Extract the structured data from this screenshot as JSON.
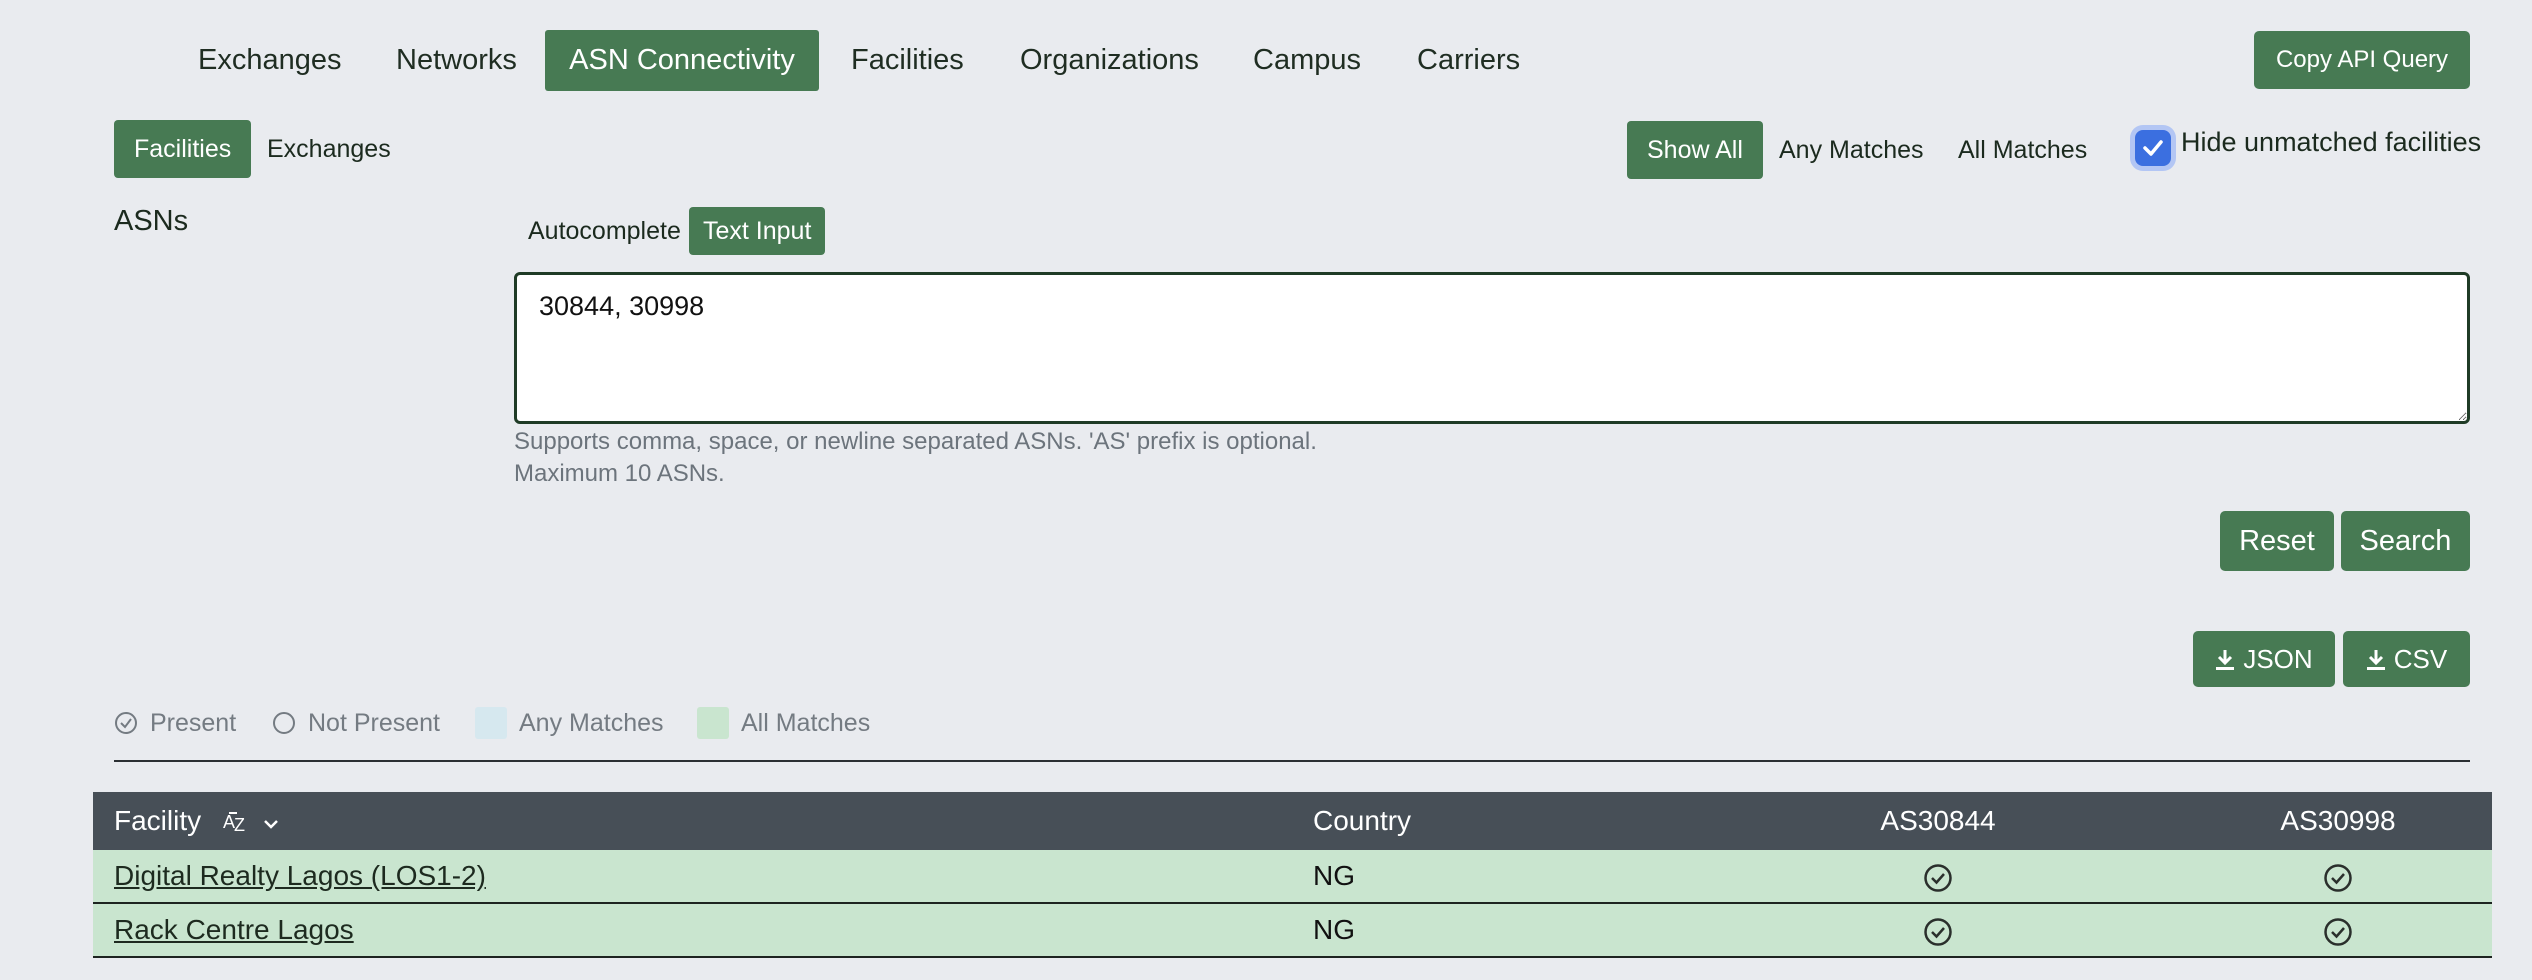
{
  "nav": {
    "tabs": [
      "Exchanges",
      "Networks",
      "ASN Connectivity",
      "Facilities",
      "Organizations",
      "Campus",
      "Carriers"
    ],
    "active_tab": "ASN Connectivity",
    "copy_api_label": "Copy API Query"
  },
  "mode_toggle": {
    "facilities": "Facilities",
    "exchanges": "Exchanges",
    "active": "Facilities"
  },
  "match_filter": {
    "show_all": "Show All",
    "any_matches": "Any Matches",
    "all_matches": "All Matches",
    "active": "Show All"
  },
  "hide_unmatched": {
    "label": "Hide unmatched facilities",
    "checked": true
  },
  "asns_label": "ASNs",
  "input_mode": {
    "autocomplete": "Autocomplete",
    "text_input": "Text Input",
    "active": "Text Input"
  },
  "asn_input": {
    "value": "30844, 30998"
  },
  "help_text": {
    "line1": "Supports comma, space, or newline separated ASNs. 'AS' prefix is optional.",
    "line2": "Maximum 10 ASNs."
  },
  "actions": {
    "reset": "Reset",
    "search": "Search",
    "json": "JSON",
    "csv": "CSV"
  },
  "legend": {
    "present": "Present",
    "not_present": "Not Present",
    "any_matches": "Any Matches",
    "all_matches": "All Matches"
  },
  "colors": {
    "accent": "#477a53",
    "any_match_swatch": "#d6e8ef",
    "all_match_swatch": "#c9e5cf",
    "table_header": "#474f57"
  },
  "table": {
    "headers": {
      "facility": "Facility",
      "country": "Country",
      "asn1": "AS30844",
      "asn2": "AS30998"
    },
    "sort_icon": "sort-az-icon",
    "rows": [
      {
        "facility": "Digital Realty Lagos (LOS1-2)",
        "country": "NG",
        "asn1": "present",
        "asn2": "present"
      },
      {
        "facility": "Rack Centre Lagos",
        "country": "NG",
        "asn1": "present",
        "asn2": "present"
      }
    ]
  }
}
